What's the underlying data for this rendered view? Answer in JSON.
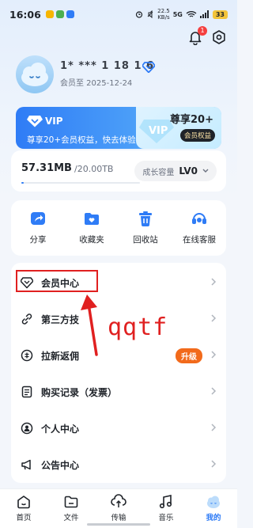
{
  "status_bar": {
    "time": "16:06",
    "speed_value": "22.5",
    "speed_unit": "KB/s",
    "network": "5G",
    "battery": "33"
  },
  "header": {
    "notification_count": "1"
  },
  "profile": {
    "username": "1* *** 1 18 1 6",
    "member_until": "会员至 2025-12-24"
  },
  "vip_banner": {
    "logo_text": "VIP",
    "subtitle": "尊享20+会员权益，快去体验 ›",
    "promo_title": "尊享20+",
    "promo_tag": "会员权益"
  },
  "storage": {
    "used": "57.31MB",
    "total": "/20.00TB",
    "used_fraction": 0.02,
    "growth_label": "成长容量",
    "growth_level": "LV0"
  },
  "quick_actions": [
    {
      "label": "分享",
      "icon": "share-icon"
    },
    {
      "label": "收藏夹",
      "icon": "folder-heart-icon"
    },
    {
      "label": "回收站",
      "icon": "trash-icon"
    },
    {
      "label": "在线客服",
      "icon": "headset-icon"
    }
  ],
  "menu": [
    {
      "label": "会员中心",
      "icon": "diamond-icon"
    },
    {
      "label": "第三方技",
      "icon": "link-icon"
    },
    {
      "label": "拉新返佣",
      "icon": "coin-icon",
      "badge": "升级"
    },
    {
      "label": "购买记录（发票）",
      "icon": "receipt-icon"
    },
    {
      "label": "个人中心",
      "icon": "person-icon"
    },
    {
      "label": "公告中心",
      "icon": "megaphone-icon"
    }
  ],
  "annotation": {
    "text": "qqtf"
  },
  "bottom_nav": [
    {
      "label": "首页",
      "icon": "home-icon"
    },
    {
      "label": "文件",
      "icon": "file-icon"
    },
    {
      "label": "传输",
      "icon": "transfer-icon"
    },
    {
      "label": "音乐",
      "icon": "music-icon"
    },
    {
      "label": "我的",
      "icon": "profile-icon",
      "active": true
    }
  ],
  "colors": {
    "accent": "#2f7cf6",
    "upgrade_badge": "#f26a1b",
    "annotation_red": "#e02020"
  }
}
